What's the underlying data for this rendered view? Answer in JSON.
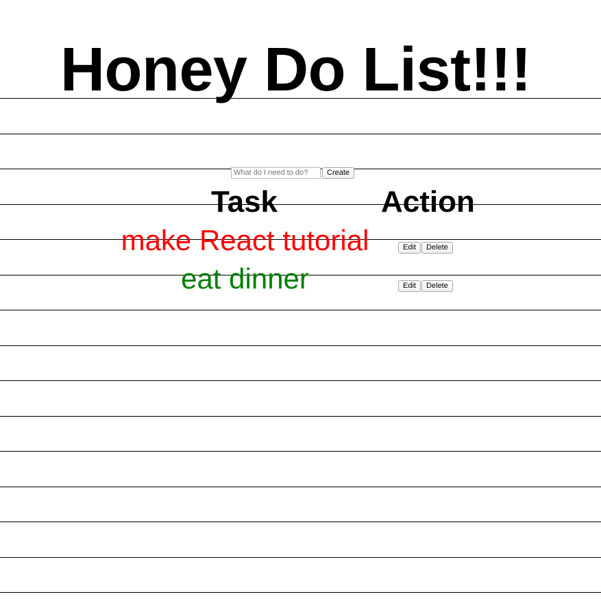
{
  "title": "Honey Do List!!!",
  "form": {
    "input_placeholder": "What do I need to do?",
    "input_value": "",
    "create_label": "Create"
  },
  "table": {
    "headers": {
      "task": "Task",
      "action": "Action"
    },
    "rows": [
      {
        "task": "make React tutorial",
        "color": "#ff0000",
        "edit_label": "Edit",
        "delete_label": "Delete"
      },
      {
        "task": "eat dinner",
        "color": "#008000",
        "edit_label": "Edit",
        "delete_label": "Delete"
      }
    ]
  }
}
